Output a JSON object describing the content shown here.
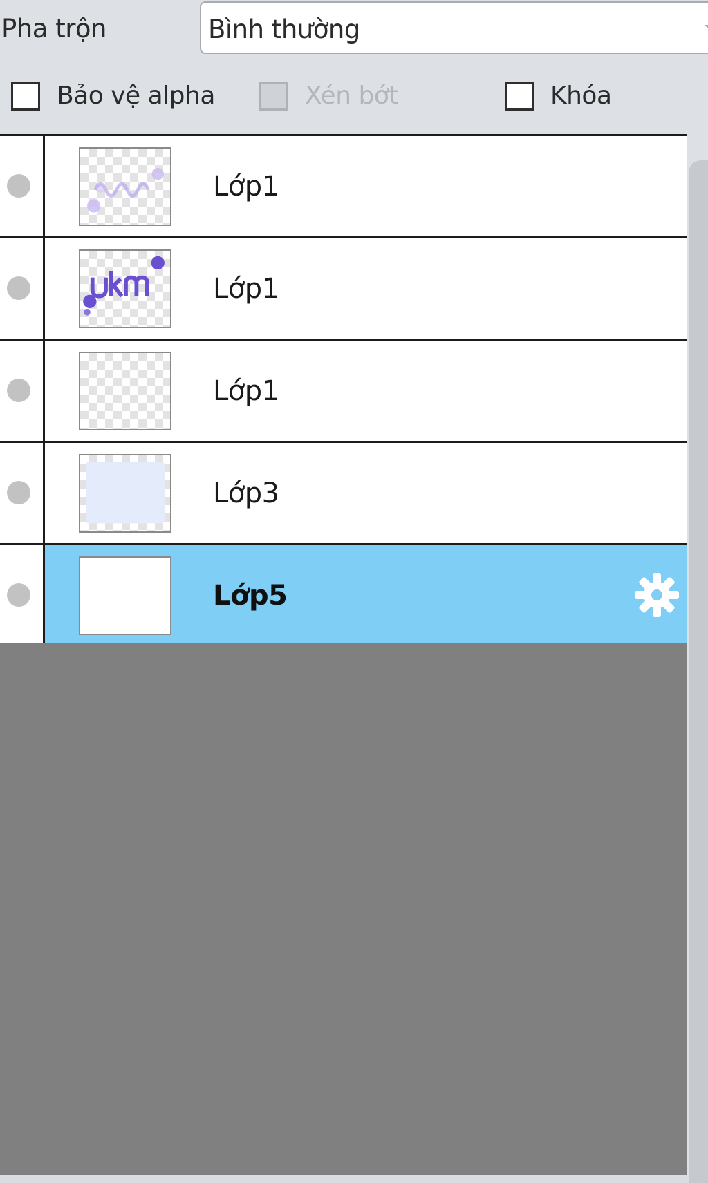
{
  "blend": {
    "label": "Pha trộn",
    "value": "Bình thường"
  },
  "options": {
    "protect_alpha": {
      "label": "Bảo vệ alpha",
      "checked": false,
      "enabled": true
    },
    "clipping": {
      "label": "Xén bớt",
      "checked": false,
      "enabled": false
    },
    "lock": {
      "label": "Khóa",
      "checked": false,
      "enabled": true
    }
  },
  "layers": [
    {
      "name": "Lớp1",
      "selected": false
    },
    {
      "name": "Lớp1",
      "selected": false
    },
    {
      "name": "Lớp1",
      "selected": false
    },
    {
      "name": "Lớp3",
      "selected": false
    },
    {
      "name": "Lớp5",
      "selected": true
    }
  ],
  "icons": {
    "visibility": "visibility-dot-icon",
    "settings": "gear-icon"
  },
  "colors": {
    "selected_row": "#7ecef6",
    "empty_area": "#808080",
    "panel": "#dde1e6"
  }
}
